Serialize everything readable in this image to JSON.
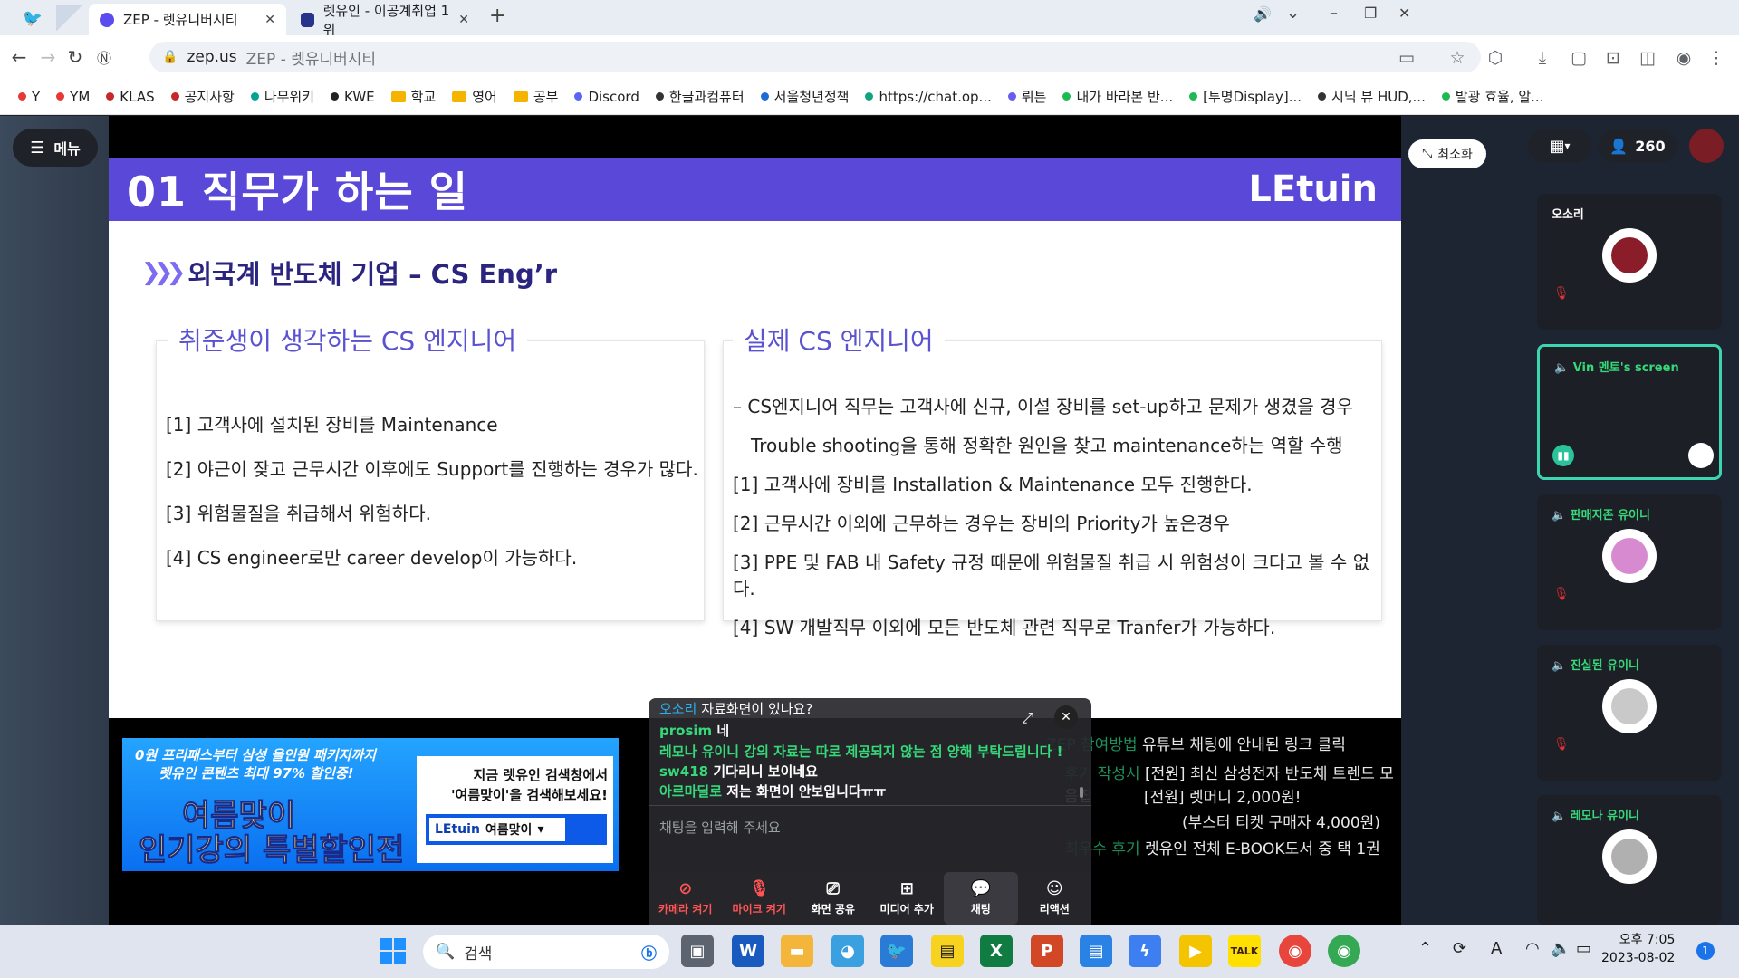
{
  "browser": {
    "tabs": [
      {
        "title": "ZEP - 렛유니버시티",
        "active": true
      },
      {
        "title": "렛유인 - 이공계취업 1위",
        "active": false
      }
    ],
    "new_tab": "+",
    "url_host": "zep.us",
    "url_rest": "ZEP - 렛유니버시티",
    "bookmarks": [
      {
        "label": "Y",
        "color": "#e53935"
      },
      {
        "label": "YM",
        "color": "#e53935"
      },
      {
        "label": "KLAS",
        "color": "#c62828"
      },
      {
        "label": "공지사항",
        "color": "#c62828"
      },
      {
        "label": "나무위키",
        "color": "#00a495"
      },
      {
        "label": "KWE",
        "color": "#222222"
      },
      {
        "label": "학교",
        "color": "folder"
      },
      {
        "label": "영어",
        "color": "folder"
      },
      {
        "label": "공부",
        "color": "folder"
      },
      {
        "label": "Discord",
        "color": "#5865f2"
      },
      {
        "label": "한글과컴퓨터",
        "color": "#333333"
      },
      {
        "label": "서울청년정책",
        "color": "#1e6bd6"
      },
      {
        "label": "https://chat.op...",
        "color": "#10a37f"
      },
      {
        "label": "뤼튼",
        "color": "#6a5cf0"
      },
      {
        "label": "내가 바라본 반...",
        "color": "#1db954"
      },
      {
        "label": "[투명Display]...",
        "color": "#1db954"
      },
      {
        "label": "시닉 뷰 HUD,...",
        "color": "#333333"
      },
      {
        "label": "발광 효율, 알...",
        "color": "#1db954"
      }
    ]
  },
  "zep": {
    "menu_label": "메뉴",
    "minimize_label": "최소화",
    "user_count": "260"
  },
  "slide": {
    "title": "01 직무가 하는 일",
    "logo": "LEtuin",
    "section_title": "외국계 반도체 기업 – CS Eng’r",
    "left_card": {
      "title": "취준생이 생각하는 CS 엔지니어",
      "items": [
        "[1] 고객사에 설치된 장비를 Maintenance",
        "[2] 야근이 잦고 근무시간 이후에도 Support를 진행하는 경우가 많다.",
        "[3] 위험물질을 취급해서 위험하다.",
        "[4] CS engineer로만 career develop이 가능하다."
      ]
    },
    "right_card": {
      "title": "실제 CS 엔지니어",
      "items": [
        "– CS엔지니어 직무는 고객사에 신규, 이설 장비를 set-up하고 문제가 생겼을 경우",
        "Trouble shooting을 통해 정확한 원인을 찾고 maintenance하는 역할 수행",
        "[1] 고객사에 장비를 Installation & Maintenance 모두 진행한다.",
        "[2] 근무시간 이외에 근무하는 경우는 장비의 Priority가 높은경우",
        "[3] PPE 및 FAB 내 Safety 규정 때문에 위험물질 취급 시 위험성이 크다고 볼 수 없다.",
        "[4] SW 개발직무 이외에 모든 반도체 관련 직무로 Tranfer가 가능하다."
      ]
    }
  },
  "banner": {
    "line1": "0원 프리패스부터 삼성 올인원 패키지까지",
    "line2": "렛유인 콘텐츠 최대 97% 할인중!",
    "big1": "여름맞이",
    "big2": "인기강의 특별할인전",
    "right1": "지금 렛유인 검색창에서",
    "right2": "'여름맞이'을 검색해보세요!",
    "search_brand": "LEtuin",
    "search_text": "여름맞이"
  },
  "info": {
    "row1_label": "ZEP 참여방법",
    "row1_text": "유튜브 채팅에 안내된 링크 클릭",
    "row2_label": "후기 작성시",
    "row2_text": "[전원] 최신 삼성전자 반도체 트렌드 모음집",
    "row3_text": "[전원] 렛머니 2,000원!",
    "row4_text": "(부스터 티켓 구매자 4,000원)",
    "row5_label": "최우수 후기",
    "row5_text": "렛유인 전체 E-BOOK도서 중 택 1권"
  },
  "chat": {
    "messages": [
      {
        "user": "오소리",
        "text": "자료화면이 있나요?"
      },
      {
        "user": "prosim",
        "text": "네"
      },
      {
        "user": "레모나 유이니",
        "text": "강의 자료는 따로 제공되지 않는 점 양해 부탁드립니다 !"
      },
      {
        "user": "sw418",
        "text": "기다리니 보이네요"
      },
      {
        "user": "아르마딜로",
        "text": "저는 화면이 안보입니다ㅠㅠ"
      }
    ],
    "input_placeholder": "채팅을 입력해 주세요",
    "controls": [
      {
        "label": "카메라 켜기",
        "icon": "camera-off-icon"
      },
      {
        "label": "마이크 켜기",
        "icon": "mic-off-icon"
      },
      {
        "label": "화면 공유",
        "icon": "screen-share-icon"
      },
      {
        "label": "미디어 추가",
        "icon": "media-add-icon"
      },
      {
        "label": "채팅",
        "icon": "chat-icon"
      },
      {
        "label": "리액션",
        "icon": "reaction-icon"
      }
    ]
  },
  "participants": [
    {
      "name": "오소리",
      "speaking": false
    },
    {
      "name": "Vin 멘토's screen",
      "speaking": true
    },
    {
      "name": "판매지존 유이니",
      "speaking": true
    },
    {
      "name": "진실된 유이니",
      "speaking": true
    },
    {
      "name": "레모나 유이니",
      "speaking": true
    }
  ],
  "taskbar": {
    "search_label": "검색",
    "time": "오후 7:05",
    "date": "2023-08-02",
    "notification_count": "1",
    "ime": "A"
  },
  "colors": {
    "slide_header": "#5a48d8",
    "accent_green": "#36d97a",
    "accent_red": "#e03030"
  }
}
